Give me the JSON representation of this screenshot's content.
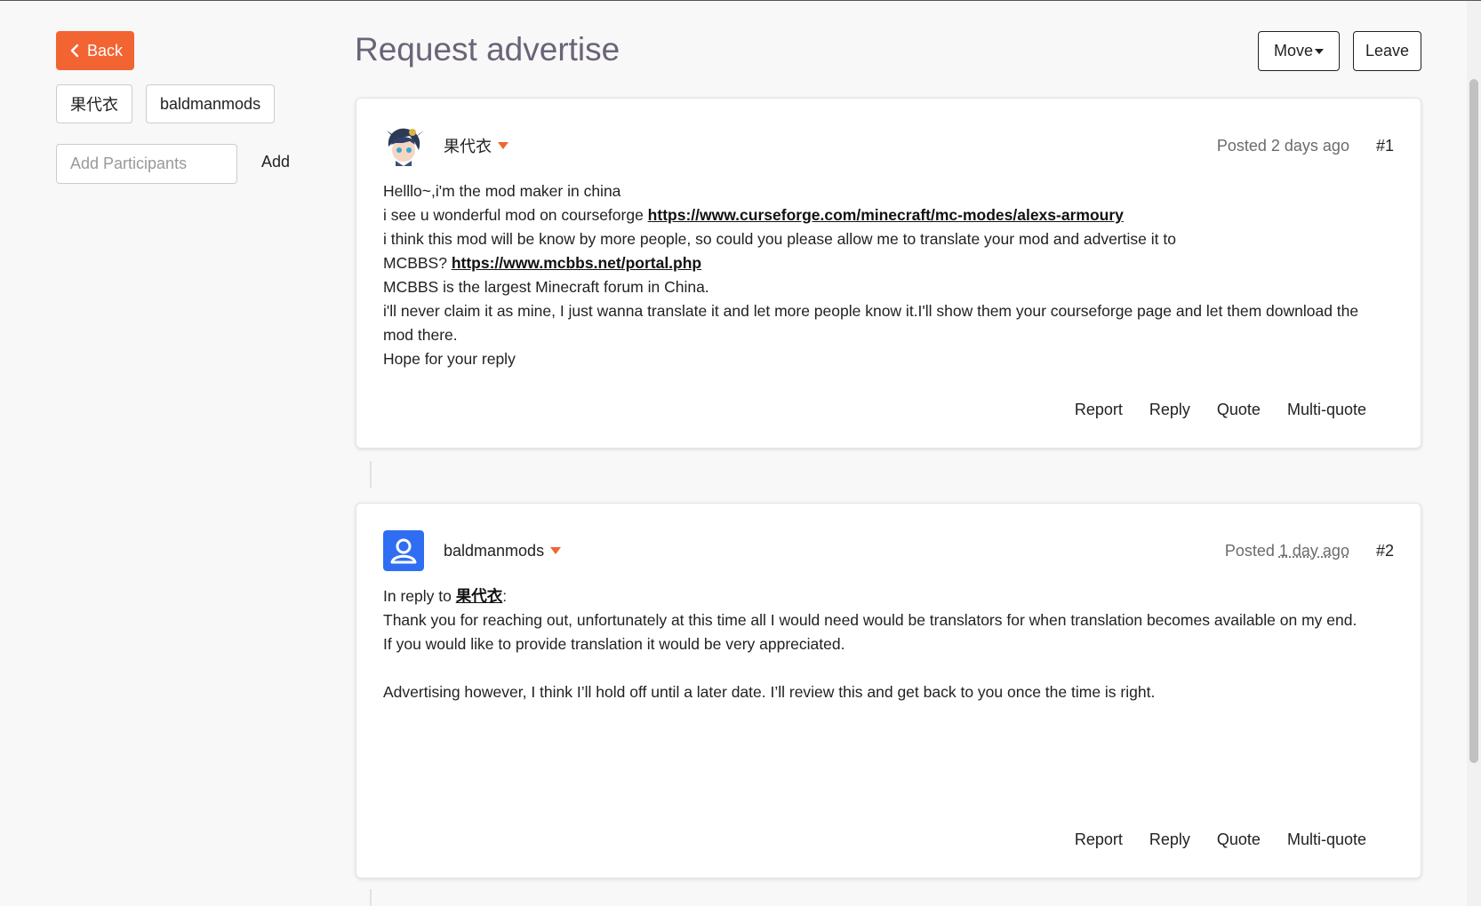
{
  "nav": {
    "back_label": "Back"
  },
  "participants": [
    "果代衣",
    "baldmanmods"
  ],
  "add_participants": {
    "placeholder": "Add Participants",
    "add_label": "Add"
  },
  "header": {
    "title": "Request advertise",
    "move_label": "Move",
    "leave_label": "Leave"
  },
  "colors": {
    "accent": "#f26432",
    "title": "#6b6478",
    "avatar_blue": "#2f6ef2"
  },
  "posts": [
    {
      "author": "果代衣",
      "posted_prefix": "Posted",
      "posted_ago": "2 days ago",
      "number": "#1",
      "lines": [
        {
          "text": "Helllo~,i'm the mod maker in china"
        },
        {
          "pre": "i see u wonderful mod on courseforge ",
          "link": "https://www.curseforge.com/minecraft/mc-modes/alexs-armoury"
        },
        {
          "text": "i think this mod will be know by more people, so could you please allow me to translate your mod and advertise it to"
        },
        {
          "pre": "MCBBS? ",
          "link": "https://www.mcbbs.net/portal.php"
        },
        {
          "text": "MCBBS is the largest Minecraft forum in China."
        },
        {
          "text": "i'll never claim it as mine, I just wanna translate it and let more people know it.I'll show them your courseforge page and let them download the"
        },
        {
          "text": "mod there."
        },
        {
          "text": "Hope for your reply"
        }
      ],
      "actions": [
        "Report",
        "Reply",
        "Quote",
        "Multi-quote"
      ]
    },
    {
      "author": "baldmanmods",
      "posted_prefix": "Posted",
      "posted_ago": "1 day ago",
      "number": "#2",
      "reply_prefix": "In reply to ",
      "reply_to": "果代衣",
      "reply_suffix": ":",
      "lines": [
        {
          "text": "Thank you for reaching out, unfortunately at this time all I would need would be translators for when translation becomes available on my end."
        },
        {
          "text": "If you would like to provide translation it would be very appreciated."
        },
        {
          "text": ""
        },
        {
          "text": "Advertising however, I think I’ll hold off until a later date. I’ll review this and get back to you once the time is right."
        }
      ],
      "actions": [
        "Report",
        "Reply",
        "Quote",
        "Multi-quote"
      ]
    }
  ]
}
